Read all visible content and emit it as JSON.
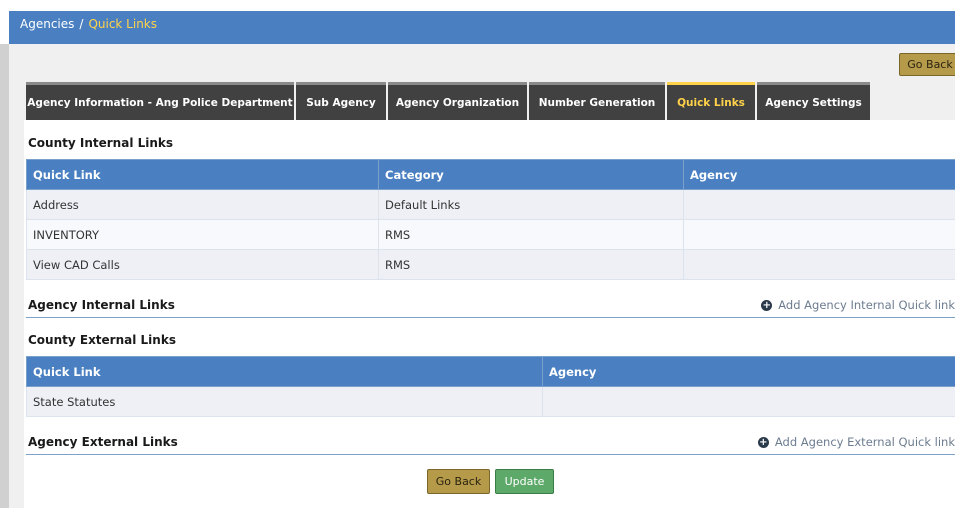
{
  "breadcrumb": {
    "parent": "Agencies",
    "separator": "/",
    "current": "Quick Links"
  },
  "buttons": {
    "go_back_top": "Go Back",
    "go_back_bottom": "Go Back",
    "update": "Update"
  },
  "tabs": [
    {
      "label": "Agency Information - Ang Police Department",
      "active": false
    },
    {
      "label": "Sub Agency",
      "active": false
    },
    {
      "label": "Agency Organization",
      "active": false
    },
    {
      "label": "Number Generation",
      "active": false
    },
    {
      "label": "Quick Links",
      "active": true
    },
    {
      "label": "Agency Settings",
      "active": false
    }
  ],
  "county_internal": {
    "title": "County Internal Links",
    "columns": [
      "Quick Link",
      "Category",
      "Agency"
    ],
    "rows": [
      [
        "Address",
        "Default Links",
        ""
      ],
      [
        "INVENTORY",
        "RMS",
        ""
      ],
      [
        "View CAD Calls",
        "RMS",
        ""
      ]
    ]
  },
  "agency_internal": {
    "title": "Agency Internal Links",
    "add_label": "Add Agency Internal Quick link",
    "icon": "plus-circle-icon"
  },
  "county_external": {
    "title": "County External Links",
    "columns": [
      "Quick Link",
      "Agency"
    ],
    "rows": [
      [
        "State Statutes",
        ""
      ]
    ]
  },
  "agency_external": {
    "title": "Agency External Links",
    "add_label": "Add Agency External Quick link",
    "icon": "plus-circle-icon"
  },
  "colors": {
    "header_blue": "#4a80c2",
    "active_tab": "#ffd24a",
    "back_button": "#b59a4a",
    "update_button": "#5ca96a"
  }
}
